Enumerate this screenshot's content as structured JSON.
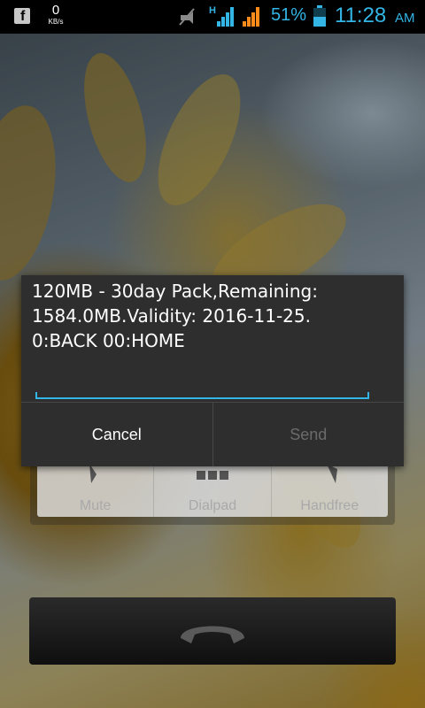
{
  "status_bar": {
    "app_icon": "facebook-icon",
    "net_speed_value": "0",
    "net_speed_unit": "KB/s",
    "network_type": "H",
    "battery_percent": "51%",
    "time": "11:28",
    "ampm": "AM",
    "accent_color": "#33b5e5"
  },
  "dialog": {
    "message": "120MB - 30day Pack,Remaining: 1584.0MB.Validity: 2016-11-25.\n0:BACK 00:HOME",
    "input_value": "",
    "cancel_label": "Cancel",
    "send_label": "Send"
  },
  "call_controls": {
    "buttons": [
      {
        "label": "Mute",
        "icon": "microphone-icon"
      },
      {
        "label": "Dialpad",
        "icon": "dialpad-icon"
      },
      {
        "label": "Handfree",
        "icon": "speaker-icon"
      }
    ],
    "end_call_icon": "end-call-icon"
  }
}
